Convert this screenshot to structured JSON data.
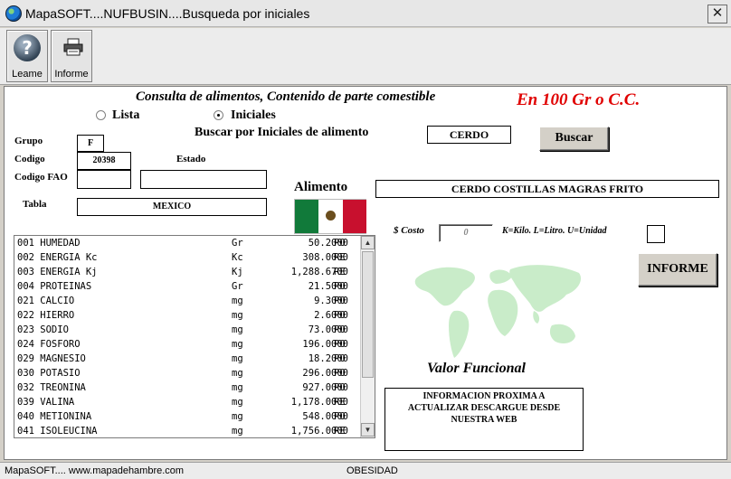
{
  "window": {
    "title": "MapaSOFT....NUFBUSIN....Busqueda por iniciales",
    "close_glyph": "✕"
  },
  "toolbar": {
    "readme_label": "Leame",
    "report_label": "Informe"
  },
  "header": {
    "title": "Consulta de alimentos, Contenido de parte comestible",
    "per_unit": "En 100 Gr  o C.C."
  },
  "search": {
    "mode_list": "Lista",
    "mode_initials": "Iniciales",
    "selected_mode": "Iniciales",
    "prompt": "Buscar por Iniciales de alimento",
    "query": "CERDO",
    "button": "Buscar"
  },
  "fields": {
    "grupo_label": "Grupo",
    "grupo_value": "F",
    "codigo_label": "Codigo",
    "codigo_value": "20398",
    "estado_label": "Estado",
    "codigo_fao_label": "Codigo FAO",
    "tabla_label": "Tabla",
    "tabla_value": "MEXICO"
  },
  "food": {
    "label": "Alimento",
    "name": "CERDO COSTILLAS MAGRAS FRITO"
  },
  "flag_colors": {
    "left": "#117a3a",
    "center": "#ffffff",
    "right": "#c8102e"
  },
  "cost": {
    "label": "$ Costo",
    "value": "0",
    "units_legend": "K=Kilo. L=Litro. U=Unidad"
  },
  "report_button": "INFORME",
  "functional": {
    "title": "Valor Funcional",
    "info": "INFORMACION PROXIMA A ACTUALIZAR  DESCARGUE DESDE NUESTRA WEB"
  },
  "nutrients": [
    {
      "name": "001 HUMEDAD",
      "unit": "Gr",
      "value": "50.2000",
      "src": "PO"
    },
    {
      "name": "002 ENERGIA Kc",
      "unit": "Kc",
      "value": "308.0000",
      "src": "RE"
    },
    {
      "name": "003 ENERGIA Kj",
      "unit": "Kj",
      "value": "1,288.6700",
      "src": "RE"
    },
    {
      "name": "004 PROTEINAS",
      "unit": "Gr",
      "value": "21.5000",
      "src": "PO"
    },
    {
      "name": "021 CALCIO",
      "unit": "mg",
      "value": "9.3000",
      "src": "PO"
    },
    {
      "name": "022 HIERRO",
      "unit": "mg",
      "value": "2.6000",
      "src": "PO"
    },
    {
      "name": "023 SODIO",
      "unit": "mg",
      "value": "73.0000",
      "src": "PO"
    },
    {
      "name": "024 FOSFORO",
      "unit": "mg",
      "value": "196.0000",
      "src": "PO"
    },
    {
      "name": "029 MAGNESIO",
      "unit": "mg",
      "value": "18.2000",
      "src": "PO"
    },
    {
      "name": "030 POTASIO",
      "unit": "mg",
      "value": "296.0000",
      "src": "PO"
    },
    {
      "name": "032 TREONINA",
      "unit": "mg",
      "value": "927.0000",
      "src": "PO"
    },
    {
      "name": "039 VALINA",
      "unit": "mg",
      "value": "1,178.0000",
      "src": "RE"
    },
    {
      "name": "040 METIONINA",
      "unit": "mg",
      "value": "548.0000",
      "src": "PO"
    },
    {
      "name": "041 ISOLEUCINA",
      "unit": "mg",
      "value": "1,756.0000",
      "src": "RE"
    }
  ],
  "status": {
    "left": "MapaSOFT.... www.mapadehambre.com",
    "center": "OBESIDAD"
  }
}
